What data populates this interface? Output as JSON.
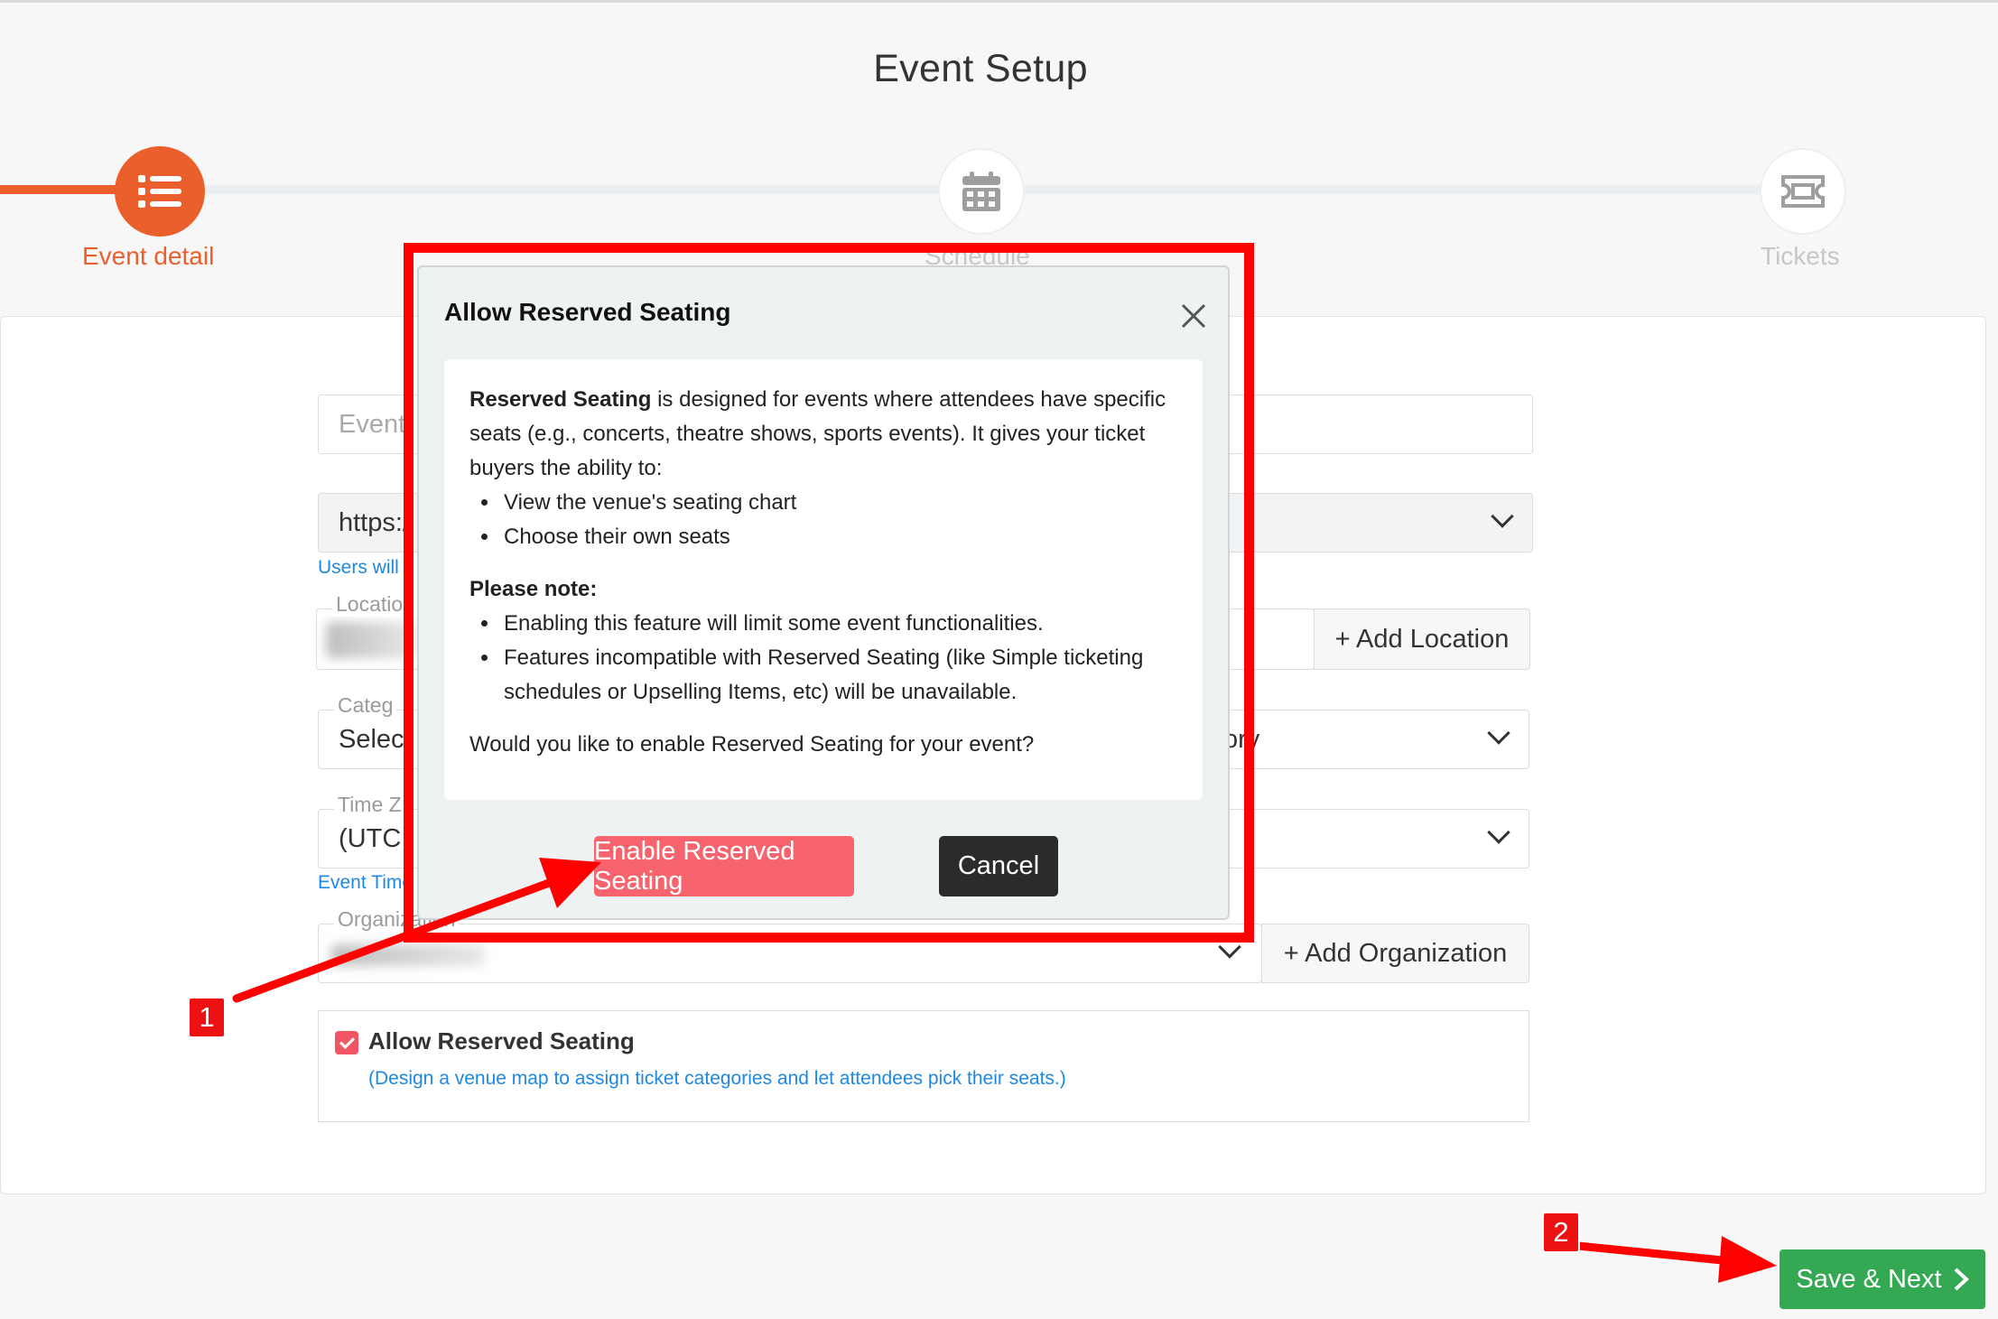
{
  "page": {
    "title": "Event Setup"
  },
  "stepper": {
    "steps": [
      {
        "label": "Event detail",
        "icon": "list-icon",
        "state": "active"
      },
      {
        "label": "Schedule",
        "icon": "calendar-icon",
        "state": "inactive"
      },
      {
        "label": "Tickets",
        "icon": "ticket-icon",
        "state": "inactive"
      }
    ]
  },
  "form": {
    "event_name_placeholder": "Event",
    "url_prefix": "https:/",
    "url_hint": "Users will",
    "location_label": "Location",
    "add_location": "+ Add Location",
    "category_label": "Categ",
    "category_value": "Selec",
    "category_value_tail": "ory",
    "timezone_label": "Time Z",
    "timezone_value": "(UTC",
    "timezone_hint": "Event Time",
    "organization_label": "Organization",
    "add_organization": "+ Add Organization",
    "reserved_seating": {
      "checked": true,
      "label": "Allow Reserved Seating",
      "description": "(Design a venue map to assign ticket categories and let attendees pick their seats.)"
    }
  },
  "modal": {
    "title": "Allow Reserved Seating",
    "intro_bold": "Reserved Seating",
    "intro_rest": " is designed for events where attendees have specific seats (e.g., concerts, theatre shows, sports events). It gives your ticket buyers the ability to:",
    "abilities": [
      "View the venue's seating chart",
      "Choose their own seats"
    ],
    "note_heading": "Please note:",
    "notes": [
      "Enabling this feature will limit some event functionalities.",
      "Features incompatible with Reserved Seating (like Simple ticketing schedules or Upselling Items, etc) will be unavailable."
    ],
    "question": "Would you like to enable Reserved Seating for your event?",
    "enable_button": "Enable Reserved Seating",
    "cancel_button": "Cancel"
  },
  "footer": {
    "save_next": "Save & Next"
  },
  "annotations": {
    "badge_1": "1",
    "badge_2": "2"
  },
  "colors": {
    "accent": "#ea5f2b",
    "enable_button": "#f8646e",
    "cancel_button": "#2b2b2b",
    "save_button": "#34a853",
    "annotation_red": "#ff0000",
    "hint_blue": "#1e88e5"
  }
}
